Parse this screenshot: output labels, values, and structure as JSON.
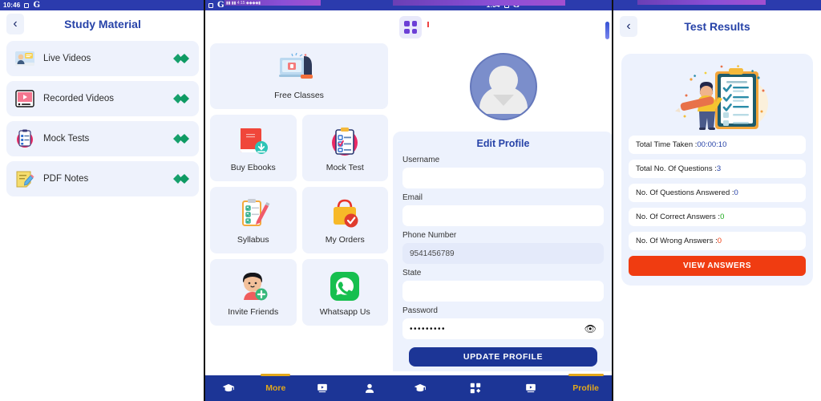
{
  "panels": {
    "study_material": {
      "status_bar": {
        "time": "10:46",
        "icons": [
          "square-icon",
          "google-g-icon"
        ]
      },
      "header": {
        "title": "Study Material",
        "back_icon": "chevron-left-icon"
      },
      "items": [
        {
          "label": "Live Videos",
          "icon": "live-video-icon",
          "arrow": "green-arrow-icon"
        },
        {
          "label": "Recorded Videos",
          "icon": "recorded-video-icon",
          "arrow": "green-arrow-icon"
        },
        {
          "label": "Mock Tests",
          "icon": "clipboard-test-icon",
          "arrow": "green-arrow-icon"
        },
        {
          "label": "PDF Notes",
          "icon": "pdf-notes-icon",
          "arrow": "green-arrow-icon"
        }
      ]
    },
    "more_menu": {
      "status_bar": {
        "icons": [
          "square-icon",
          "google-g-icon"
        ]
      },
      "featured": {
        "label": "Free Classes",
        "icon": "free-classes-icon"
      },
      "tiles": [
        {
          "label": "Buy Ebooks",
          "icon": "ebook-download-icon"
        },
        {
          "label": "Mock Test",
          "icon": "mock-test-icon"
        },
        {
          "label": "Syllabus",
          "icon": "syllabus-icon"
        },
        {
          "label": "My Orders",
          "icon": "shopping-bag-check-icon"
        },
        {
          "label": "Invite Friends",
          "icon": "invite-friend-icon"
        },
        {
          "label": "Whatsapp Us",
          "icon": "whatsapp-icon"
        }
      ],
      "bottom_nav": [
        {
          "label": "",
          "icon": "graduation-cap-icon",
          "active": false
        },
        {
          "label": "More",
          "icon": "",
          "active": true
        },
        {
          "label": "",
          "icon": "video-screen-icon",
          "active": false
        },
        {
          "label": "",
          "icon": "person-icon",
          "active": false
        }
      ]
    },
    "edit_profile": {
      "status_bar": {
        "time": "1:34",
        "icons": [
          "square-icon",
          "google-g-icon"
        ]
      },
      "grid_chip_icon": "grid-apps-icon",
      "avatar_icon": "default-avatar-icon",
      "form_title": "Edit Profile",
      "fields": [
        {
          "label": "Username",
          "value": "",
          "placeholder": "",
          "filled": false
        },
        {
          "label": "Email",
          "value": "",
          "placeholder": "",
          "filled": false
        },
        {
          "label": "Phone Number",
          "value": "9541456789",
          "placeholder": "",
          "filled": true
        },
        {
          "label": "State",
          "value": "",
          "placeholder": "",
          "filled": false
        }
      ],
      "password": {
        "label": "Password",
        "value": "•••••••••",
        "toggle_icon": "eye-icon"
      },
      "submit_label": "UPDATE PROFILE",
      "bottom_nav": [
        {
          "label": "",
          "icon": "graduation-cap-icon",
          "active": false
        },
        {
          "label": "",
          "icon": "grid-apps-icon",
          "active": false
        },
        {
          "label": "",
          "icon": "video-screen-icon",
          "active": false
        },
        {
          "label": "Profile",
          "icon": "",
          "active": true
        }
      ]
    },
    "test_results": {
      "header": {
        "title": "Test Results",
        "back_icon": "chevron-left-icon"
      },
      "illustration_icon": "checklist-person-icon",
      "rows": [
        {
          "label": "Total Time Taken : ",
          "value": "00:00:10",
          "value_color": "#2743a8"
        },
        {
          "label": "Total No. Of Questions : ",
          "value": "3",
          "value_color": "#2743a8"
        },
        {
          "label": "No. Of Questions Answered : ",
          "value": "0",
          "value_color": "#2743a8"
        },
        {
          "label": "No. Of Correct Answers : ",
          "value": "0",
          "value_color": "#1aa81a"
        },
        {
          "label": "No. Of Wrong Answers : ",
          "value": "0",
          "value_color": "#f03c11"
        }
      ],
      "view_answers_label": "VIEW ANSWERS"
    }
  },
  "colors": {
    "status_bar": "#2b3bad",
    "nav_bar": "#1c3596",
    "accent_gold": "#e3a81b",
    "title_blue": "#2743a8",
    "card_bg": "#edf2fd",
    "danger_orange": "#f03c11",
    "success_green": "#1aa81a",
    "purple_chip": "#6c3fd6"
  }
}
